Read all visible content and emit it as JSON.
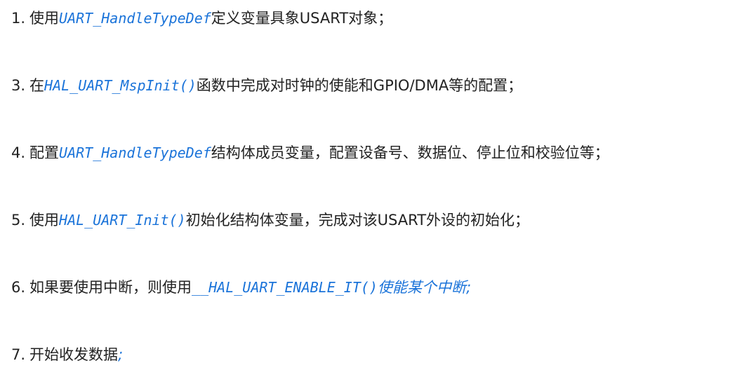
{
  "steps": [
    {
      "num": "1.",
      "before": "使用",
      "code": "UART_HandleTypeDef",
      "after": "定义变量具象USART对象；"
    },
    {
      "num": "3.",
      "before": "在",
      "code": "HAL_UART_MspInit()",
      "after": "函数中完成对时钟的使能和GPIO/DMA等的配置；"
    },
    {
      "num": "4.",
      "before": "配置",
      "code": "UART_HandleTypeDef",
      "after": "结构体成员变量，配置设备号、数据位、停止位和校验位等；"
    },
    {
      "num": "5.",
      "before": "使用",
      "code": "HAL_UART_Init()",
      "after": "初始化结构体变量，完成对该USART外设的初始化；"
    },
    {
      "num": "6.",
      "before": "如果要使用中断，则使用",
      "code": "__HAL_UART_ENABLE_IT()",
      "after": "使能某个中断;"
    },
    {
      "num": "7.",
      "before": "开始收发数据",
      "code": ";",
      "after": ""
    }
  ],
  "colors": {
    "code": "#1a73d9",
    "text": "#222222",
    "background": "#ffffff"
  }
}
